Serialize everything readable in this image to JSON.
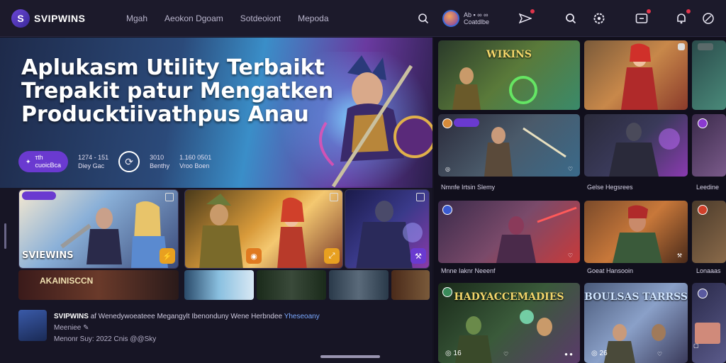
{
  "header": {
    "logo_mark": "S",
    "logo_text": "SVIPWINS",
    "nav": [
      "Mgah",
      "Aeokon Dgoam",
      "Sotdeoiont",
      "Mepoda"
    ],
    "user_line1": "Ab ▪ ∞ ∞",
    "user_line2": "Coatdlbe"
  },
  "hero": {
    "title_lines": [
      "Aplukasm Utility Terbaikt",
      "Trepakit patur Mengatken",
      "Producktiivathpus Anau"
    ],
    "pill_icon": "✦",
    "pill_line1": "τth",
    "pill_line2": "cuoicBca",
    "stat1_line1": "1274 - 151",
    "stat1_line2": "Diey Gac",
    "stat2_line1": "3010",
    "stat2_line2": "Benthy",
    "stat3_line1": "1.160 0501",
    "stat3_line2": "Vroo Boen"
  },
  "cards": {
    "card1_label": "SVIEWINS",
    "thumb_label": "AKAINISCCN"
  },
  "footer": {
    "brand": "SVIPWINS",
    "line1_text": "af Wenedywoeateee Megangylt Ibenonduny Wene Herbndee",
    "line1_link": "Yheseoany",
    "line2": "Meeniee ✎",
    "line3": "Menonr Suy:  2022 Cnis @@Sky"
  },
  "tiles": {
    "t1_title": "WIKINS",
    "t5_caption": "Nmnfe Irtsin Slemy",
    "t6_caption": "Gelse Hegsrees",
    "t7_caption": "Leedine",
    "t8_caption": "Mnne Iaknr Neeenf",
    "t9_caption": "Goeat Hansooin",
    "t10_caption": "Lonaaas",
    "t11_title": "HADYACCEMADIES",
    "t12_title": "BOULSAS TARRSS",
    "t11_count": "16",
    "t12_count": "26"
  },
  "colors": {
    "accent": "#6a3ad0",
    "bg": "#14121f",
    "panel": "#1c1a2b",
    "link": "#7aa8ff"
  }
}
